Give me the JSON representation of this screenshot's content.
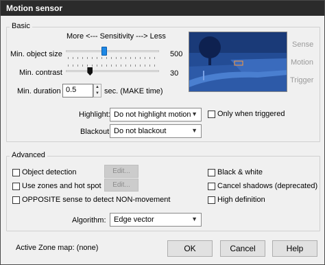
{
  "window": {
    "title": "Motion sensor"
  },
  "basic": {
    "group_label": "Basic",
    "sensitivity_label": "More <--- Sensitivity ---> Less",
    "min_object_size": {
      "label": "Min. object size",
      "value": "500"
    },
    "min_contrast": {
      "label": "Min. contrast",
      "value": "30"
    },
    "min_duration": {
      "label": "Min. duration",
      "value": "0.5",
      "unit": "sec.  (MAKE time)"
    },
    "highlight": {
      "label": "Highlight:",
      "selected": "Do not highlight motion"
    },
    "only_when_triggered": {
      "label": "Only when triggered",
      "checked": false
    },
    "blackout": {
      "label": "Blackout:",
      "selected": "Do not blackout"
    },
    "indicators": {
      "sense": "Sense",
      "motion": "Motion",
      "trigger": "Trigger"
    }
  },
  "advanced": {
    "group_label": "Advanced",
    "object_detection": {
      "label": "Object detection",
      "checked": false
    },
    "use_zones": {
      "label": "Use zones and hot spot",
      "checked": false
    },
    "opposite_sense": {
      "label": "OPPOSITE sense to detect NON-movement",
      "checked": false
    },
    "edit_label_1": "Edit...",
    "edit_label_2": "Edit...",
    "black_white": {
      "label": "Black & white",
      "checked": false
    },
    "cancel_shadows": {
      "label": "Cancel shadows (deprecated)",
      "checked": false
    },
    "high_definition": {
      "label": "High definition",
      "checked": false
    },
    "algorithm": {
      "label": "Algorithm:",
      "selected": "Edge vector"
    }
  },
  "footer": {
    "active_zone_map": "Active Zone map:  (none)",
    "ok": "OK",
    "cancel": "Cancel",
    "help": "Help"
  },
  "colors": {
    "slider_thumb": "#1e88e5",
    "titlebar": "#2b2b2b",
    "preview_tint": "#1c3f7e"
  },
  "sliders": {
    "min_object_size_fraction": 0.41,
    "min_contrast_fraction": 0.26
  }
}
